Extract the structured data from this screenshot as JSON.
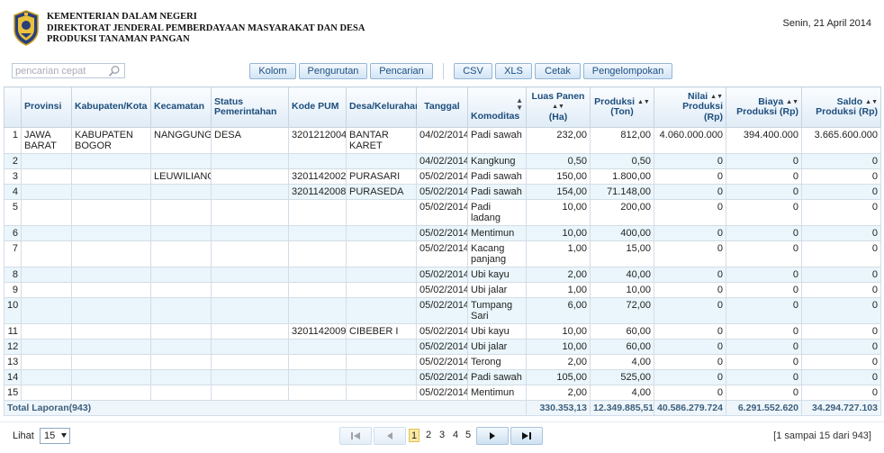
{
  "header": {
    "org_line1": "KEMENTERIAN DALAM NEGERI",
    "org_line2": "DIREKTORAT JENDERAL PEMBERDAYAAN MASYARAKAT DAN DESA",
    "org_line3": "PRODUKSI TANAMAN PANGAN",
    "date": "Senin, 21 April 2014"
  },
  "search": {
    "placeholder": "pencarian cepat",
    "value": ""
  },
  "toolbar": {
    "kolom": "Kolom",
    "pengurutan": "Pengurutan",
    "pencarian": "Pencarian",
    "csv": "CSV",
    "xls": "XLS",
    "cetak": "Cetak",
    "pengelompokan": "Pengelompokan"
  },
  "table": {
    "headers": {
      "provinsi": "Provinsi",
      "kabupaten": "Kabupaten/Kota",
      "kecamatan": "Kecamatan",
      "status_1": "Status",
      "status_2": "Pemerintahan",
      "kode": "Kode PUM",
      "desa": "Desa/Kelurahan",
      "tanggal": "Tanggal",
      "komoditas": "Komoditas",
      "luas_1": "Luas Panen",
      "luas_2": "(Ha)",
      "produksi_1": "Produksi",
      "produksi_2": "(Ton)",
      "nilai_1": "Nilai",
      "nilai_2": "Produksi",
      "nilai_3": "(Rp)",
      "biaya_1": "Biaya",
      "biaya_2": "Produksi (Rp)",
      "saldo_1": "Saldo",
      "saldo_2": "Produksi (Rp)"
    },
    "rows": [
      {
        "no": "1",
        "provinsi": "JAWA BARAT",
        "kabupaten": "KABUPATEN BOGOR",
        "kecamatan": "NANGGUNG",
        "status": "DESA",
        "kode": "3201212004",
        "desa": "BANTAR KARET",
        "tanggal": "04/02/2014",
        "komoditas": "Padi sawah",
        "luas": "232,00",
        "produksi": "812,00",
        "nilai": "4.060.000.000",
        "biaya": "394.400.000",
        "saldo": "3.665.600.000"
      },
      {
        "no": "2",
        "provinsi": "",
        "kabupaten": "",
        "kecamatan": "",
        "status": "",
        "kode": "",
        "desa": "",
        "tanggal": "04/02/2014",
        "komoditas": "Kangkung",
        "luas": "0,50",
        "produksi": "0,50",
        "nilai": "0",
        "biaya": "0",
        "saldo": "0"
      },
      {
        "no": "3",
        "provinsi": "",
        "kabupaten": "",
        "kecamatan": "LEUWILIANG",
        "status": "",
        "kode": "3201142002",
        "desa": "PURASARI",
        "tanggal": "05/02/2014",
        "komoditas": "Padi sawah",
        "luas": "150,00",
        "produksi": "1.800,00",
        "nilai": "0",
        "biaya": "0",
        "saldo": "0"
      },
      {
        "no": "4",
        "provinsi": "",
        "kabupaten": "",
        "kecamatan": "",
        "status": "",
        "kode": "3201142008",
        "desa": "PURASEDA",
        "tanggal": "05/02/2014",
        "komoditas": "Padi sawah",
        "luas": "154,00",
        "produksi": "71.148,00",
        "nilai": "0",
        "biaya": "0",
        "saldo": "0"
      },
      {
        "no": "5",
        "provinsi": "",
        "kabupaten": "",
        "kecamatan": "",
        "status": "",
        "kode": "",
        "desa": "",
        "tanggal": "05/02/2014",
        "komoditas": "Padi ladang",
        "luas": "10,00",
        "produksi": "200,00",
        "nilai": "0",
        "biaya": "0",
        "saldo": "0"
      },
      {
        "no": "6",
        "provinsi": "",
        "kabupaten": "",
        "kecamatan": "",
        "status": "",
        "kode": "",
        "desa": "",
        "tanggal": "05/02/2014",
        "komoditas": "Mentimun",
        "luas": "10,00",
        "produksi": "400,00",
        "nilai": "0",
        "biaya": "0",
        "saldo": "0"
      },
      {
        "no": "7",
        "provinsi": "",
        "kabupaten": "",
        "kecamatan": "",
        "status": "",
        "kode": "",
        "desa": "",
        "tanggal": "05/02/2014",
        "komoditas": "Kacang panjang",
        "luas": "1,00",
        "produksi": "15,00",
        "nilai": "0",
        "biaya": "0",
        "saldo": "0"
      },
      {
        "no": "8",
        "provinsi": "",
        "kabupaten": "",
        "kecamatan": "",
        "status": "",
        "kode": "",
        "desa": "",
        "tanggal": "05/02/2014",
        "komoditas": "Ubi kayu",
        "luas": "2,00",
        "produksi": "40,00",
        "nilai": "0",
        "biaya": "0",
        "saldo": "0"
      },
      {
        "no": "9",
        "provinsi": "",
        "kabupaten": "",
        "kecamatan": "",
        "status": "",
        "kode": "",
        "desa": "",
        "tanggal": "05/02/2014",
        "komoditas": "Ubi jalar",
        "luas": "1,00",
        "produksi": "10,00",
        "nilai": "0",
        "biaya": "0",
        "saldo": "0"
      },
      {
        "no": "10",
        "provinsi": "",
        "kabupaten": "",
        "kecamatan": "",
        "status": "",
        "kode": "",
        "desa": "",
        "tanggal": "05/02/2014",
        "komoditas": "Tumpang Sari",
        "luas": "6,00",
        "produksi": "72,00",
        "nilai": "0",
        "biaya": "0",
        "saldo": "0"
      },
      {
        "no": "11",
        "provinsi": "",
        "kabupaten": "",
        "kecamatan": "",
        "status": "",
        "kode": "3201142009",
        "desa": "CIBEBER I",
        "tanggal": "05/02/2014",
        "komoditas": "Ubi kayu",
        "luas": "10,00",
        "produksi": "60,00",
        "nilai": "0",
        "biaya": "0",
        "saldo": "0"
      },
      {
        "no": "12",
        "provinsi": "",
        "kabupaten": "",
        "kecamatan": "",
        "status": "",
        "kode": "",
        "desa": "",
        "tanggal": "05/02/2014",
        "komoditas": "Ubi jalar",
        "luas": "10,00",
        "produksi": "60,00",
        "nilai": "0",
        "biaya": "0",
        "saldo": "0"
      },
      {
        "no": "13",
        "provinsi": "",
        "kabupaten": "",
        "kecamatan": "",
        "status": "",
        "kode": "",
        "desa": "",
        "tanggal": "05/02/2014",
        "komoditas": "Terong",
        "luas": "2,00",
        "produksi": "4,00",
        "nilai": "0",
        "biaya": "0",
        "saldo": "0"
      },
      {
        "no": "14",
        "provinsi": "",
        "kabupaten": "",
        "kecamatan": "",
        "status": "",
        "kode": "",
        "desa": "",
        "tanggal": "05/02/2014",
        "komoditas": "Padi sawah",
        "luas": "105,00",
        "produksi": "525,00",
        "nilai": "0",
        "biaya": "0",
        "saldo": "0"
      },
      {
        "no": "15",
        "provinsi": "",
        "kabupaten": "",
        "kecamatan": "",
        "status": "",
        "kode": "",
        "desa": "",
        "tanggal": "05/02/2014",
        "komoditas": "Mentimun",
        "luas": "2,00",
        "produksi": "4,00",
        "nilai": "0",
        "biaya": "0",
        "saldo": "0"
      }
    ],
    "total": {
      "label": "Total Laporan(943)",
      "luas": "330.353,13",
      "produksi": "12.349.885,51",
      "nilai": "40.586.279.724",
      "biaya": "6.291.552.620",
      "saldo": "34.294.727.103"
    }
  },
  "footer": {
    "lihat_label": "Lihat",
    "page_size": "15",
    "pages": [
      "1",
      "2",
      "3",
      "4",
      "5"
    ],
    "current_page": "1",
    "info": "[1 sampai 15 dari 943]"
  },
  "colors": {
    "header_text": "#1c4d7c",
    "row_alt": "#eaf6fb",
    "current_page": "#fbe9a3"
  }
}
